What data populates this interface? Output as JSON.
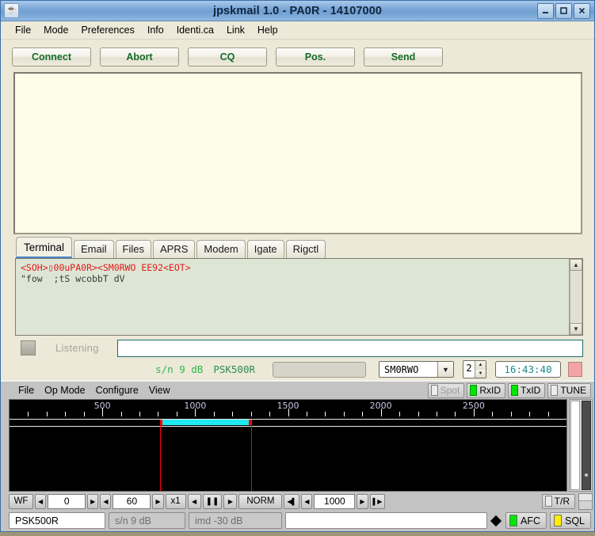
{
  "window": {
    "title": "jpskmail 1.0 - PA0R - 14107000",
    "app_icon": "java-coffee-icon",
    "controls": {
      "minimize": "minimize-icon",
      "maximize": "maximize-icon",
      "close": "close-icon"
    }
  },
  "menubar": {
    "items": [
      "File",
      "Mode",
      "Preferences",
      "Info",
      "Identi.ca",
      "Link",
      "Help"
    ]
  },
  "toolbar": {
    "buttons": [
      "Connect",
      "Abort",
      "CQ",
      "Pos.",
      "Send"
    ],
    "text_color": "#136c2a"
  },
  "main_output": {
    "value": "",
    "background": "#fdfdea"
  },
  "tabs": {
    "items": [
      "Terminal",
      "Email",
      "Files",
      "APRS",
      "Modem",
      "Igate",
      "Rigctl"
    ],
    "active": "Terminal"
  },
  "terminal": {
    "line1": "<SOH>▯00uPA0R><SM0RWO EE92<EOT>",
    "line1_color": "#e01b1b",
    "line2": "\"fow  ;tS wcobbT dV",
    "line2_color": "#3a3a3a",
    "background": "#dde6d5",
    "scrollbar": {
      "up": "scroll-up-icon",
      "down": "scroll-down-icon"
    }
  },
  "listening_row": {
    "indicator": "status-square",
    "label": "Listening",
    "input_value": "",
    "input_placeholder": ""
  },
  "status_row": {
    "sn": "s/n  9 dB",
    "sn_color": "#2eb84c",
    "mode": "PSK500R",
    "mode_color": "#2e8a57",
    "progress": "",
    "callsign_selected": "SM0RWO",
    "callsign_arrow": "chevron-down-icon",
    "spinner_value": "2",
    "clock": "16:43:40",
    "clock_color": "#1d8a8a",
    "tx_led": "tx-indicator"
  },
  "fldigi": {
    "menubar": [
      "File",
      "Op Mode",
      "Configure",
      "View"
    ],
    "toggles": [
      {
        "label": "Spot",
        "on": false,
        "dim": true
      },
      {
        "label": "RxID",
        "on": true,
        "dim": false
      },
      {
        "label": "TxID",
        "on": true,
        "dim": false
      },
      {
        "label": "TUNE",
        "on": false,
        "dim": false
      }
    ],
    "waterfall": {
      "scale_labels": [
        "500",
        "1000",
        "1500",
        "2000",
        "2500"
      ],
      "scale_max_hz": 3000,
      "band_start_hz": 810,
      "band_end_hz": 1300,
      "cursor_hz": [
        810,
        1300
      ],
      "band_color": "#1ce9f0",
      "marker_color": "#ff0000",
      "background": "#000000"
    },
    "controls": {
      "wf_button": "WF",
      "left_arrow_1": "left-arrow-icon",
      "num1": "0",
      "right_arrow_1": "right-arrow-icon",
      "left_arrow_2": "left-arrow-icon",
      "num2": "60",
      "right_arrow_2": "right-arrow-icon",
      "zoom": "x1",
      "prev": "prev-icon",
      "pause": "pause-icon",
      "next": "next-icon",
      "norm": "NORM",
      "rew": "rewind-icon",
      "step_back": "step-back-icon",
      "freq": "1000",
      "step_fwd": "step-forward-icon",
      "ffwd": "fast-forward-icon",
      "tr_label": "T/R"
    },
    "statusbar": {
      "mode": "PSK500R",
      "sn": "s/n  9 dB",
      "imd": "imd -30 dB",
      "message": "",
      "afc": {
        "label": "AFC",
        "color": "#00e600"
      },
      "sql": {
        "label": "SQL",
        "color": "#ffee00"
      }
    }
  }
}
